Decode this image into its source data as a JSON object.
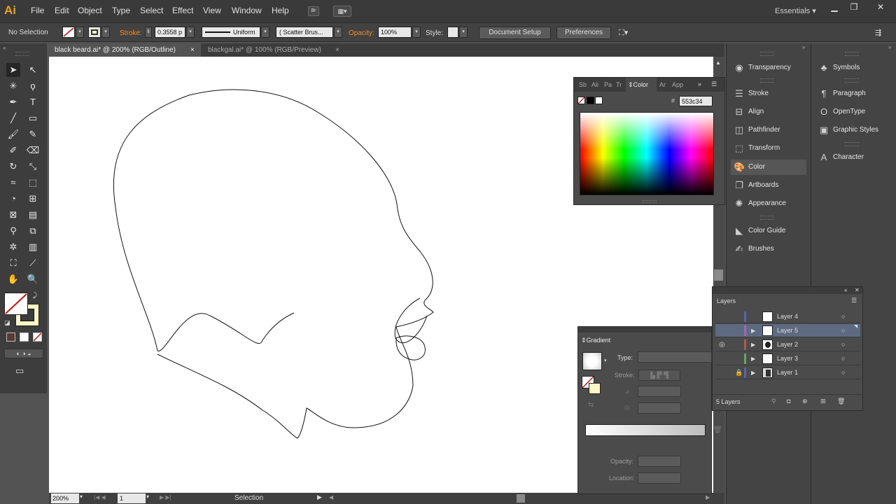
{
  "app": {
    "logo": "Ai",
    "workspace": "Essentials",
    "bridge_label": "Br"
  },
  "menu": [
    "File",
    "Edit",
    "Object",
    "Type",
    "Select",
    "Effect",
    "View",
    "Window",
    "Help"
  ],
  "control": {
    "selection_state": "No Selection",
    "stroke_label": "Stroke:",
    "stroke_weight": "0.3558 p",
    "stroke_profile": "Uniform",
    "brush": "Scatter Brus...",
    "opacity_label": "Opacity:",
    "opacity": "100%",
    "style_label": "Style:",
    "document_setup": "Document Setup",
    "preferences": "Preferences"
  },
  "tabs": [
    {
      "label": "black beard.ai* @ 200% (RGB/Outline)",
      "close": "×"
    },
    {
      "label": "blackgal.ai* @ 100% (RGB/Preview)",
      "close": "×"
    }
  ],
  "status": {
    "zoom": "200%",
    "artboard": "1",
    "tool": "Selection"
  },
  "color_panel": {
    "tabs": [
      "Sb",
      "Ali",
      "Pa",
      "Tr",
      "Color",
      "Ar",
      "App"
    ],
    "hex_label": "#",
    "hex": "553c34"
  },
  "dock1": [
    "Transparency",
    "Stroke",
    "Align",
    "Pathfinder",
    "Transform",
    "Color",
    "Artboards",
    "Appearance",
    "Color Guide",
    "Brushes"
  ],
  "dock2": [
    "Symbols",
    "Paragraph",
    "OpenType",
    "Graphic Styles",
    "Character"
  ],
  "layers": {
    "title": "Layers",
    "rows": [
      {
        "name": "Layer 4",
        "color": "#4a63d8"
      },
      {
        "name": "Layer 5",
        "color": "#c64fd6"
      },
      {
        "name": "Layer 2",
        "color": "#e0443b"
      },
      {
        "name": "Layer 3",
        "color": "#3fbf4a"
      },
      {
        "name": "Layer 1",
        "color": "#4a63d8"
      }
    ],
    "count": "5 Layers"
  },
  "gradient": {
    "title": "Gradient",
    "type_label": "Type:",
    "stroke_label": "Stroke:",
    "opacity_label": "Opacity:",
    "location_label": "Location:"
  },
  "colors": {
    "fill_swatch": "#fff6c8",
    "accent_orange": "#e8902a",
    "logo": "#e8a417"
  }
}
